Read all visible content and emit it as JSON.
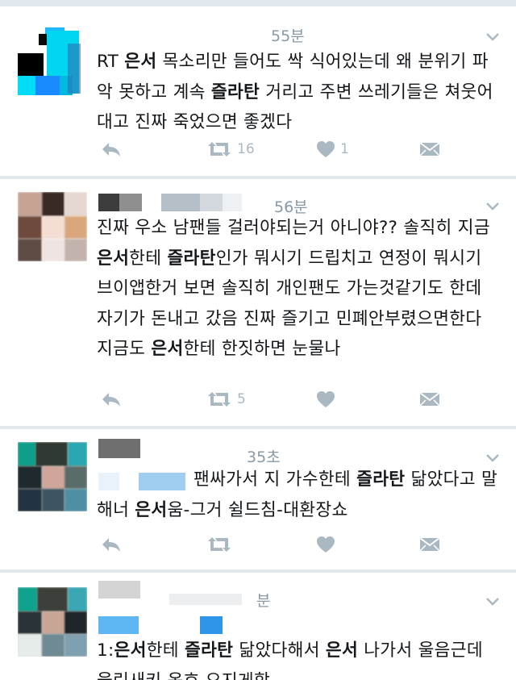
{
  "tweets": [
    {
      "time": "55분",
      "segments": [
        {
          "t": "RT ",
          "b": false
        },
        {
          "t": "은서",
          "b": true
        },
        {
          "t": " 목소리만 들어도 싹 식어있는데 왜 분위기 파악 못하고 계속 ",
          "b": false
        },
        {
          "t": "즐라탄",
          "b": true
        },
        {
          "t": " 거리고 주변 쓰레기들은 쳐웃어대고 진짜 죽었으면 좋겠다",
          "b": false
        }
      ],
      "retweets": "16",
      "likes": "1"
    },
    {
      "time": "56분",
      "segments": [
        {
          "t": "진짜 우소 남팬들 걸러야되는거 아니야?? 솔직히 지금 ",
          "b": false
        },
        {
          "t": "은서",
          "b": true
        },
        {
          "t": "한테 ",
          "b": false
        },
        {
          "t": "즐라탄",
          "b": true
        },
        {
          "t": "인가 뭐시기 드립치고 연정이 뭐시기 브이앱한거 보면 솔직히 개인팬도 가는것같기도 한데 자기가 돈내고 갔음 진짜 즐기고 민폐안부렸으면한다 지금도 ",
          "b": false
        },
        {
          "t": "은서",
          "b": true
        },
        {
          "t": "한테 한짓하면 눈물나",
          "b": false
        }
      ],
      "retweets": "5",
      "likes": ""
    },
    {
      "time": "35초",
      "segments": [
        {
          "t": "팬싸가서 지 가수한테 ",
          "b": false
        },
        {
          "t": "즐라탄",
          "b": true
        },
        {
          "t": " 닮았다고 말해너 ",
          "b": false
        },
        {
          "t": "은서",
          "b": true
        },
        {
          "t": "움-그거 쉴드침-대환장쇼",
          "b": false
        }
      ],
      "retweets": "",
      "likes": ""
    },
    {
      "time": "분",
      "segments": [
        {
          "t": "1:",
          "b": false
        },
        {
          "t": "은서",
          "b": true
        },
        {
          "t": "한테 ",
          "b": false
        },
        {
          "t": "즐라탄",
          "b": true
        },
        {
          "t": " 닮았다해서 ",
          "b": false
        },
        {
          "t": "은서",
          "b": true
        },
        {
          "t": " 나가서 울음근데 울린새키 옹호 오지게함",
          "b": false
        }
      ],
      "retweets": "",
      "likes": ""
    }
  ],
  "icons": {
    "reply": "reply-icon",
    "retweet": "retweet-icon",
    "like": "heart-icon",
    "dm": "envelope-icon",
    "more": "chevron-down-icon"
  },
  "colors": {
    "icon_gray": "#aab8c2",
    "time_gray": "#8899a6",
    "text": "#14171a",
    "divider": "#e1e8ed"
  }
}
